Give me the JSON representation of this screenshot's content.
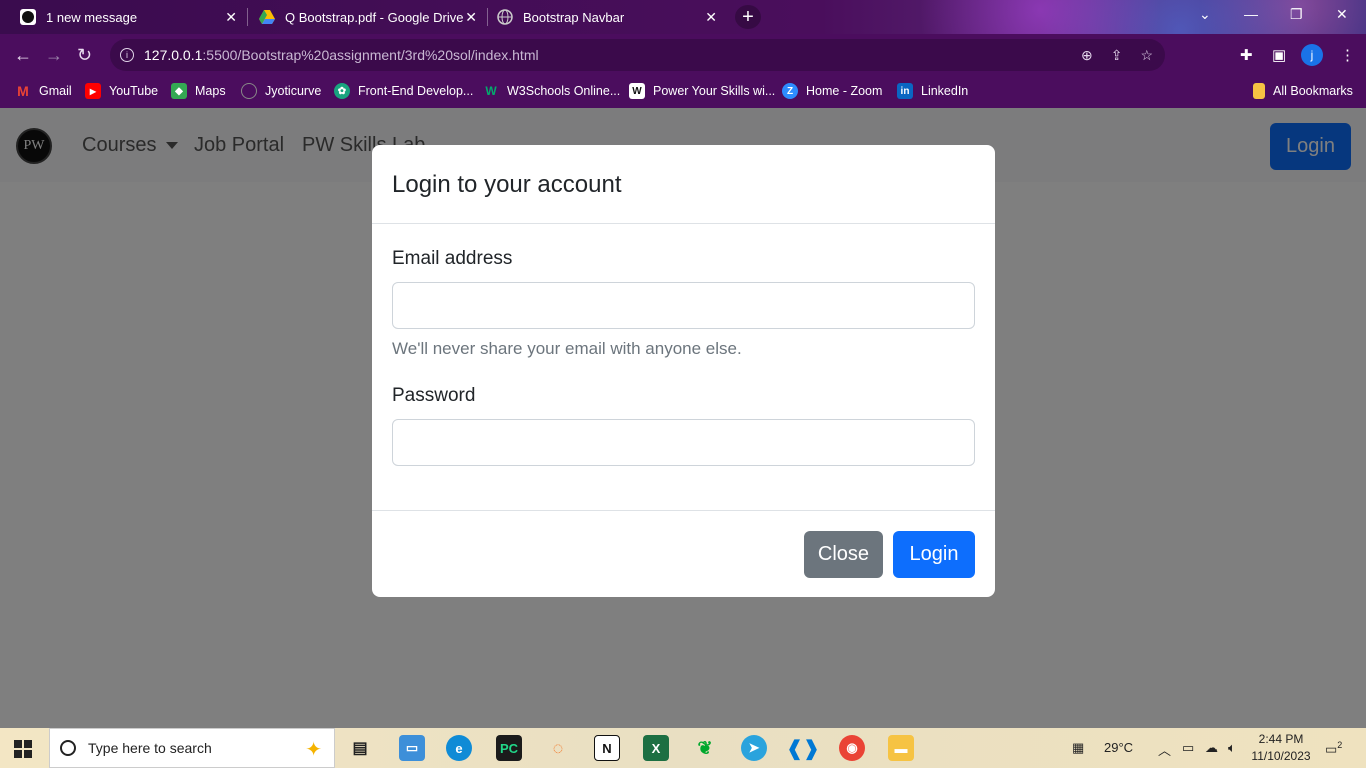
{
  "browser": {
    "tabs": [
      {
        "title": "1 new message"
      },
      {
        "title": "Q Bootstrap.pdf - Google Drive"
      },
      {
        "title": "Bootstrap Navbar"
      }
    ],
    "url_host": "127.0.0.1",
    "url_path": ":5500/Bootstrap%20assignment/3rd%20sol/index.html",
    "profile_initial": "j",
    "bookmarks": [
      {
        "label": "Gmail"
      },
      {
        "label": "YouTube"
      },
      {
        "label": "Maps"
      },
      {
        "label": "Jyoticurve"
      },
      {
        "label": "Front-End Develop..."
      },
      {
        "label": "W3Schools Online..."
      },
      {
        "label": "Power Your Skills wi..."
      },
      {
        "label": "Home - Zoom"
      },
      {
        "label": "LinkedIn"
      }
    ],
    "all_bookmarks": "All Bookmarks"
  },
  "page": {
    "logo_text": "PW",
    "nav": {
      "courses": "Courses",
      "job_portal": "Job Portal",
      "skills_lab": "PW Skills Lab",
      "login": "Login"
    },
    "modal": {
      "title": "Login to your account",
      "email_label": "Email address",
      "email_value": "",
      "email_help": "We'll never share your email with anyone else.",
      "password_label": "Password",
      "password_value": "",
      "close_label": "Close",
      "login_label": "Login"
    }
  },
  "taskbar": {
    "search_placeholder": "Type here to search",
    "temperature": "29°C",
    "time": "2:44 PM",
    "date": "11/10/2023",
    "notification_count": "2"
  }
}
